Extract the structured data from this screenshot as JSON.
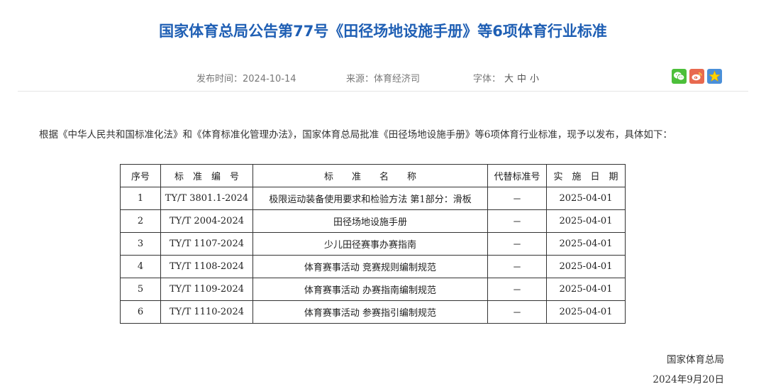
{
  "article": {
    "title": "国家体育总局公告第77号《田径场地设施手册》等6项体育行业标准",
    "meta": {
      "date": "发布时间：2024-10-14",
      "source": "来源：体育经济司",
      "font_label": "字体：",
      "font_sizes": [
        "大",
        "中",
        "小"
      ]
    },
    "share_icons": [
      "wechat-icon",
      "weibo-icon",
      "favorite-star-icon"
    ],
    "intro": "根据《中华人民共和国标准化法》和《体育标准化管理办法》，国家体育总局批准《田径场地设施手册》等6项体育行业标准，现予以发布，具体如下：",
    "table": {
      "headers": [
        "序号",
        "标　准　编　号",
        "标　　准　　名　　称",
        "代替标准号",
        "实　施　日　期"
      ],
      "rows": [
        [
          "1",
          "TY/T 3801.1-2024",
          "极限运动装备使用要求和检验方法 第1部分：滑板",
          "－",
          "2025-04-01"
        ],
        [
          "2",
          "TY/T 2004-2024",
          "田径场地设施手册",
          "－",
          "2025-04-01"
        ],
        [
          "3",
          "TY/T 1107-2024",
          "少儿田径赛事办赛指南",
          "－",
          "2025-04-01"
        ],
        [
          "4",
          "TY/T 1108-2024",
          "体育赛事活动 竞赛规则编制规范",
          "－",
          "2025-04-01"
        ],
        [
          "5",
          "TY/T 1109-2024",
          "体育赛事活动 办赛指南编制规范",
          "－",
          "2025-04-01"
        ],
        [
          "6",
          "TY/T 1110-2024",
          "体育赛事活动 参赛指引编制规范",
          "－",
          "2025-04-01"
        ]
      ]
    },
    "signature": {
      "org": "国家体育总局",
      "date": "2024年9月20日"
    }
  },
  "colors": {
    "title": "#1f5fb4",
    "wechat": "#4cbf3a",
    "weibo": "#e8694f",
    "favorite": "#4a8fd9"
  }
}
